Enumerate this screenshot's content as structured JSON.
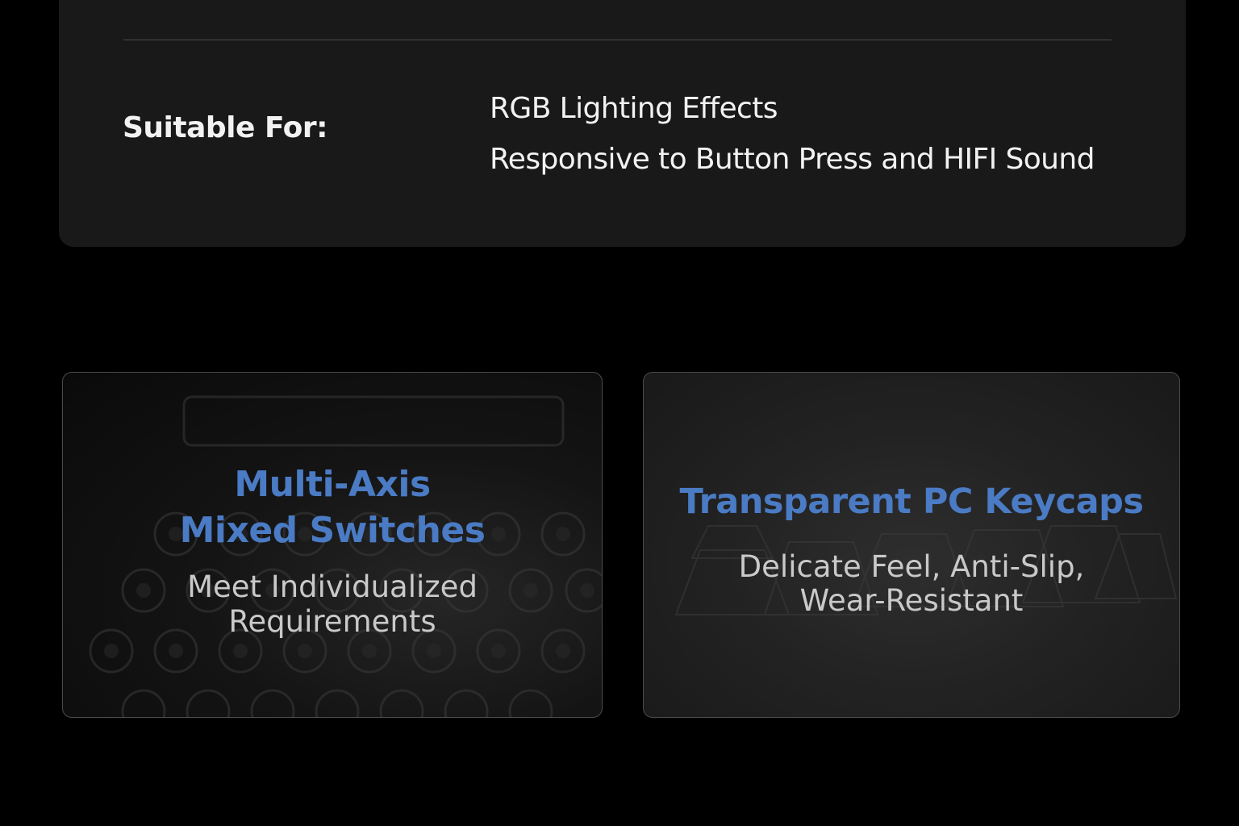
{
  "spec": {
    "label": "Suitable For:",
    "items": [
      "RGB Lighting Effects",
      "Responsive to Button Press and HIFI Sound"
    ]
  },
  "cards": [
    {
      "title_lines": [
        "Multi-Axis",
        "Mixed Switches"
      ],
      "subtitle_lines": [
        "Meet Individualized",
        "Requirements"
      ],
      "background_icon": "mechanical-switches-photo"
    },
    {
      "title_lines": [
        "Transparent PC Keycaps"
      ],
      "subtitle_lines": [
        "Delicate Feel, Anti-Slip,",
        "Wear-Resistant"
      ],
      "background_icon": "transparent-keycaps-photo"
    }
  ],
  "colors": {
    "page_background": "#000000",
    "panel_background": "#191919",
    "accent_title": "#4a7bc4",
    "text_primary": "#f2f2f2",
    "text_secondary": "#c9c9c9"
  }
}
